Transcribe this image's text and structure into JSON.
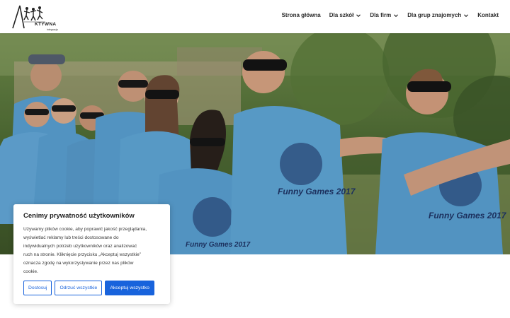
{
  "header": {
    "logo": {
      "word": "KTYWNA",
      "sub": "integracja"
    },
    "nav": [
      {
        "label": "Strona główna",
        "has_dropdown": false
      },
      {
        "label": "Dla szkół",
        "has_dropdown": true
      },
      {
        "label": "Dla firm",
        "has_dropdown": true
      },
      {
        "label": "Dla grup znajomych",
        "has_dropdown": true
      },
      {
        "label": "Kontakt",
        "has_dropdown": false
      }
    ]
  },
  "hero": {
    "shirt_texts": [
      "Funny Games 2017",
      "Funny Games 2017",
      "Funny Games 2017"
    ]
  },
  "cookie_banner": {
    "title": "Cenimy prywatność użytkowników",
    "lines": [
      "Używamy plików cookie, aby poprawić jakość przeglądania,",
      "wyświetlać reklamy lub treści dostosowane do",
      "indywidualnych potrzeb użytkowników oraz analizować",
      "ruch na stronie. Kliknięcie przycisku „Akceptuj wszystkie”",
      "oznacza zgodę na wykorzystywanie przez nas plików",
      "cookie."
    ],
    "buttons": {
      "customize": "Dostosuj",
      "reject": "Odrzuć wszystkie",
      "accept": "Akceptuj wszystko"
    }
  },
  "colors": {
    "accent": "#1863dc",
    "shirt_blue": "#5aa0d2",
    "nav_text": "#2b2b2b"
  }
}
